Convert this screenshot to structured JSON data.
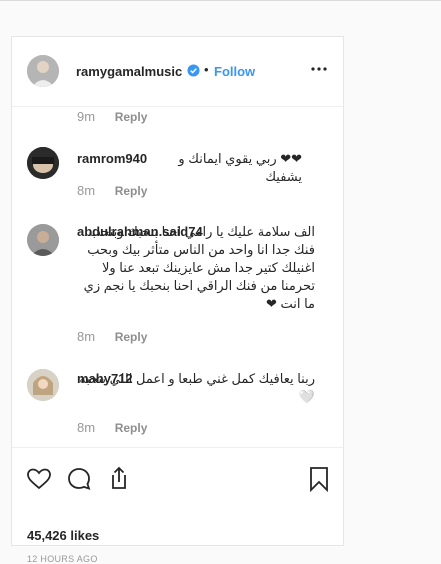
{
  "post": {
    "author": "ramygamalmusic",
    "separator": "•",
    "follow_label": "Follow",
    "likes": "45,426 likes",
    "posted_ago": "12 HOURS AGO"
  },
  "comments": [
    {
      "time": "9m",
      "reply_label": "Reply"
    },
    {
      "user": "ramrom940",
      "text": "❤❤ ربي يقوي ايمانك و يشفيك",
      "time": "8m",
      "reply_label": "Reply"
    },
    {
      "user": "abdulrahman.said74",
      "text": "الف سلامة عليك يا رامي احنا بنحبك وبنحب فنك جدا انا واحد من الناس متأثر بيك وبحب اغنيلك كتير جدا مش عايزينك تبعد عنا ولا تحرمنا من فنك الراقي احنا بنحبك يا نجم زي ما انت ❤",
      "time": "8m",
      "reply_label": "Reply"
    },
    {
      "user": "mahy712",
      "text": "ربنا يعافيك كمل غني طبعا و اعمل اللي بتحبه 🤍",
      "time": "8m",
      "reply_label": "Reply"
    }
  ],
  "colors": {
    "accent": "#3897f0",
    "verified": "#3897f0",
    "muted": "#999999"
  },
  "icons": [
    "verified-badge-icon",
    "more-options-icon",
    "heart-icon",
    "comment-icon",
    "share-icon",
    "bookmark-icon"
  ]
}
